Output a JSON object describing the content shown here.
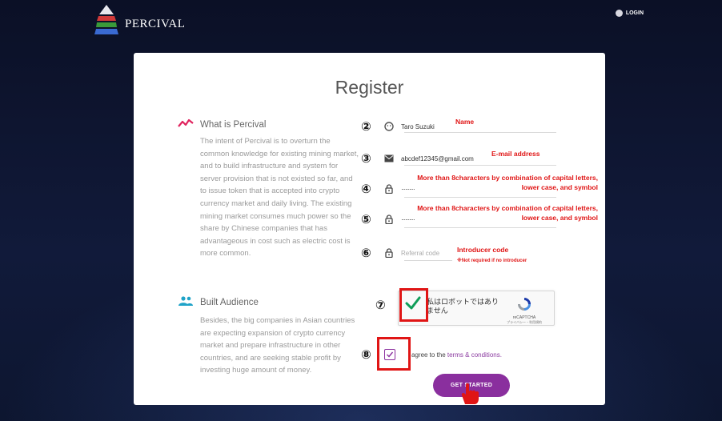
{
  "header": {
    "brand": "PERCIVAL",
    "login_label": "LOGIN"
  },
  "card": {
    "title": "Register"
  },
  "sections": [
    {
      "icon": "trend-line-icon",
      "heading": "What is Percival",
      "text": "The intent of Percival is to overturn the common knowledge for existing mining market, and to build infrastructure and system for server provision that is not existed so far, and to issue token that is accepted into crypto currency market and daily living. The existing mining market consumes much power so the share by Chinese companies that has advantageous in cost such as electric cost is more common."
    },
    {
      "icon": "people-icon",
      "heading": "Built Audience",
      "text": "Besides, the big companies in Asian countries are expecting expansion of crypto currency market and prepare infrastructure in other countries, and are seeking stable profit by investing huge amount of money."
    }
  ],
  "fields": [
    {
      "num": "②",
      "icon": "user-icon",
      "value": "Taro Suzuki",
      "placeholder": "",
      "note": "Name",
      "note_sub": ""
    },
    {
      "num": "③",
      "icon": "mail-icon",
      "value": "abcdef12345@gmail.com",
      "placeholder": "",
      "note": "E-mail address",
      "note_sub": ""
    },
    {
      "num": "④",
      "icon": "lock-icon",
      "value": "··········",
      "placeholder": "",
      "note": "More than 8characters by combination of capital letters, lower case, and symbol",
      "note_sub": ""
    },
    {
      "num": "⑤",
      "icon": "lock-icon",
      "value": "··········",
      "placeholder": "",
      "note": "More than 8characters by combination of capital letters, lower case, and symbol",
      "note_sub": ""
    },
    {
      "num": "⑥",
      "icon": "lock-icon",
      "value": "",
      "placeholder": "Referral code",
      "note": "Introducer code",
      "note_sub": "※Not required if no introducer"
    }
  ],
  "captcha": {
    "num": "⑦",
    "text": "私はロボットではありません",
    "brand": "reCAPTCHA",
    "links": "プライバシー・利用規約"
  },
  "agree": {
    "num": "⑧",
    "text": "agree to the ",
    "link": "terms & conditions."
  },
  "cta": {
    "label": "GET STARTED"
  },
  "colors": {
    "accent": "#8a2f9e",
    "annotation": "#e01515",
    "check": "#0f9d58"
  }
}
